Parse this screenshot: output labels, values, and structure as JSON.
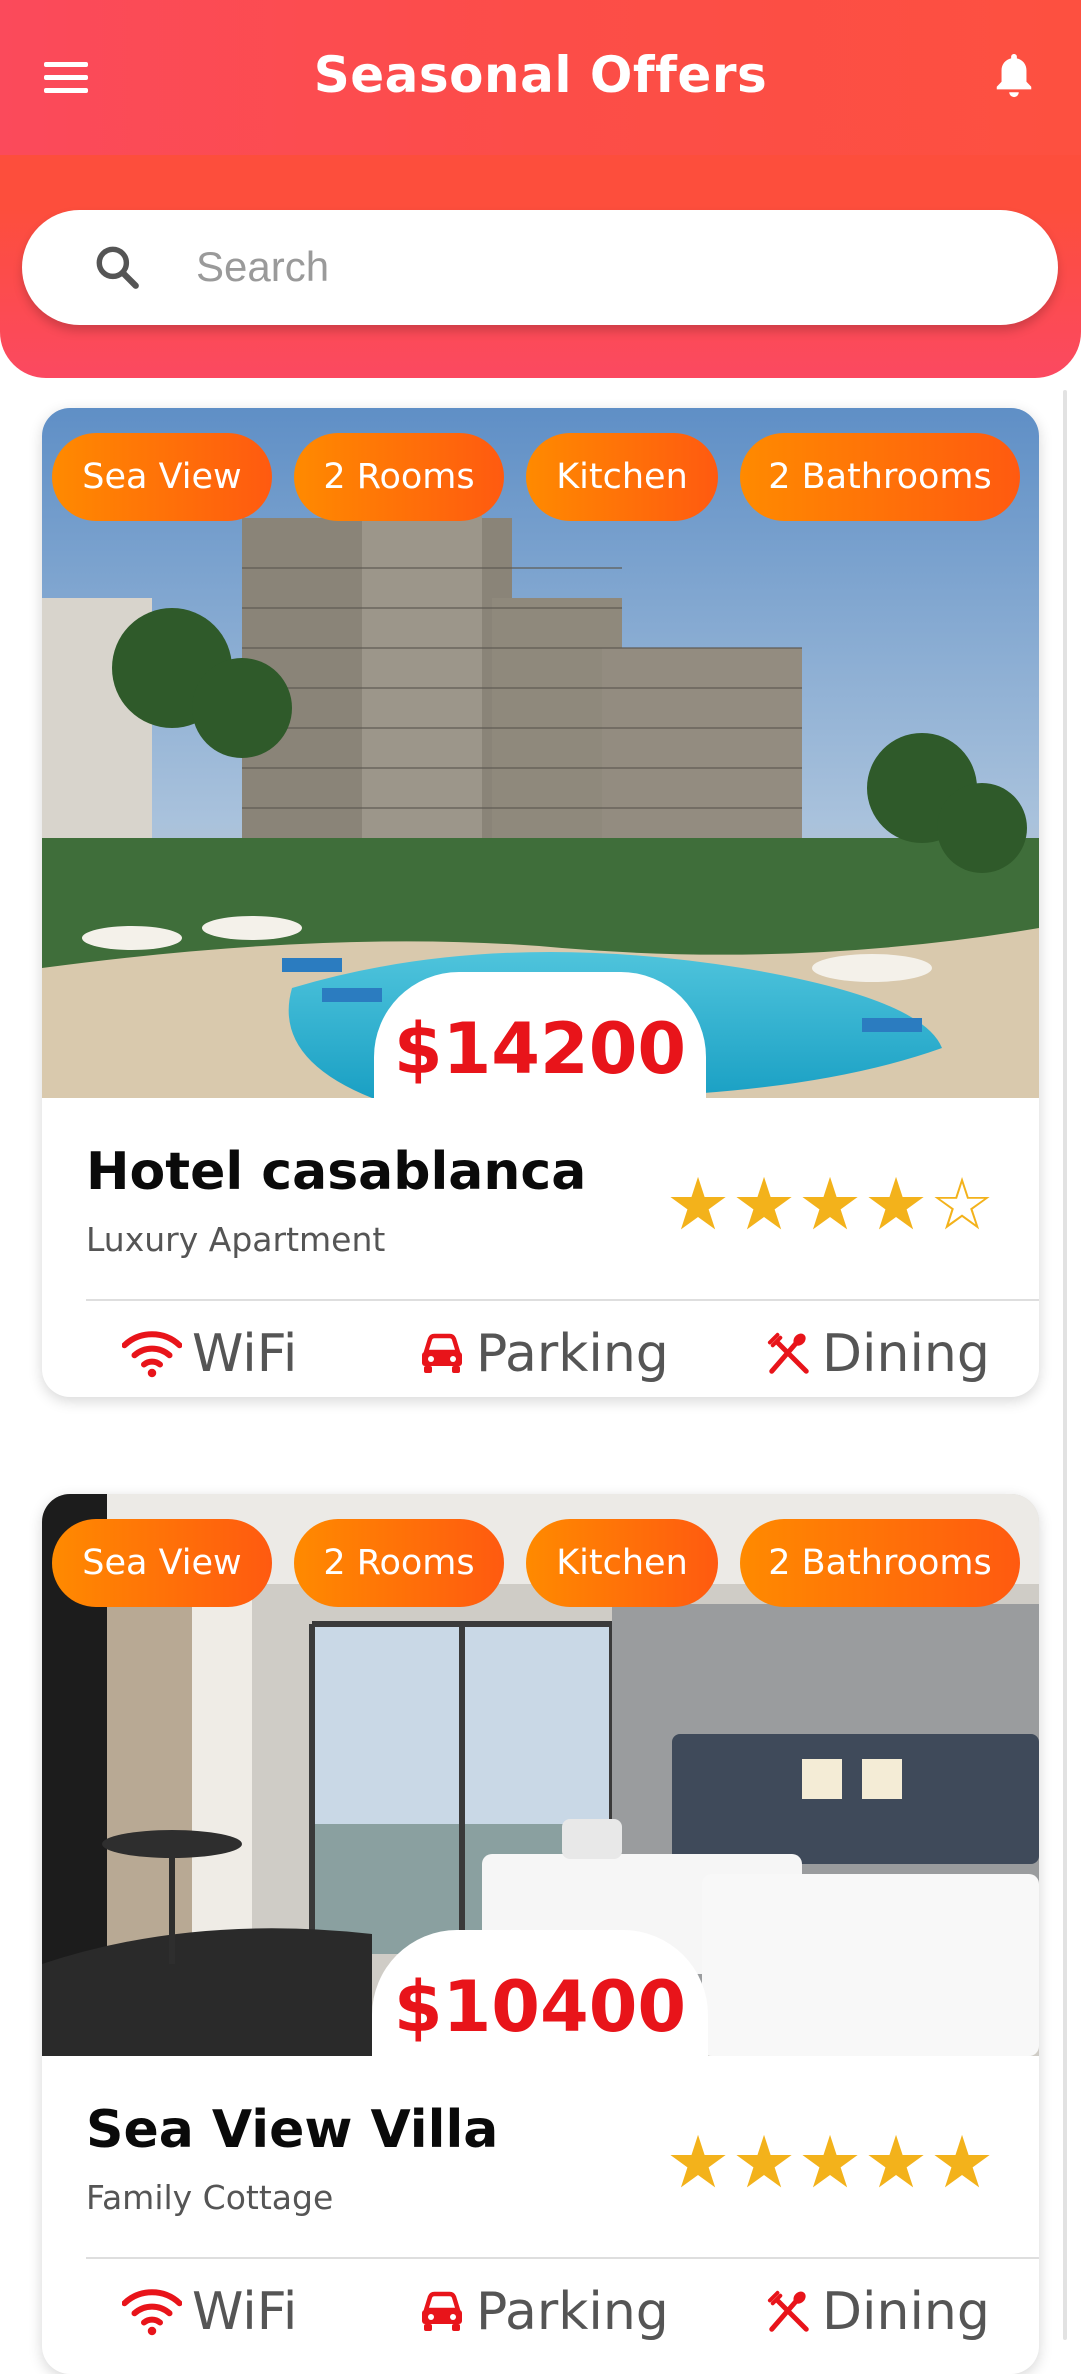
{
  "header": {
    "title": "Seasonal Offers",
    "menu_icon": "hamburger-menu-icon",
    "bell_icon": "notification-bell-icon"
  },
  "search": {
    "placeholder": "Search",
    "value": ""
  },
  "colors": {
    "header_gradient_start": "#fb4a5b",
    "header_gradient_end": "#fd5040",
    "tag_gradient_start": "#ff8a00",
    "tag_gradient_end": "#ff5a10",
    "price": "#e8141a",
    "star": "#f3b21b",
    "amenity_icon": "#e8141a"
  },
  "listings": [
    {
      "tags": [
        "Sea View",
        "2 Rooms",
        "Kitchen",
        "2 Bathrooms"
      ],
      "price": "$14200",
      "title": "Hotel casablanca",
      "subtitle": "Luxury Apartment",
      "rating": 4,
      "rating_max": 5,
      "amenities": [
        {
          "label": "WiFi",
          "icon": "wifi-icon"
        },
        {
          "label": "Parking",
          "icon": "car-icon"
        },
        {
          "label": "Dining",
          "icon": "utensils-icon"
        }
      ]
    },
    {
      "tags": [
        "Sea View",
        "2 Rooms",
        "Kitchen",
        "2 Bathrooms"
      ],
      "price": "$10400",
      "title": "Sea View Villa",
      "subtitle": "Family Cottage",
      "rating": 5,
      "rating_max": 5,
      "amenities": [
        {
          "label": "WiFi",
          "icon": "wifi-icon"
        },
        {
          "label": "Parking",
          "icon": "car-icon"
        },
        {
          "label": "Dining",
          "icon": "utensils-icon"
        }
      ]
    }
  ]
}
